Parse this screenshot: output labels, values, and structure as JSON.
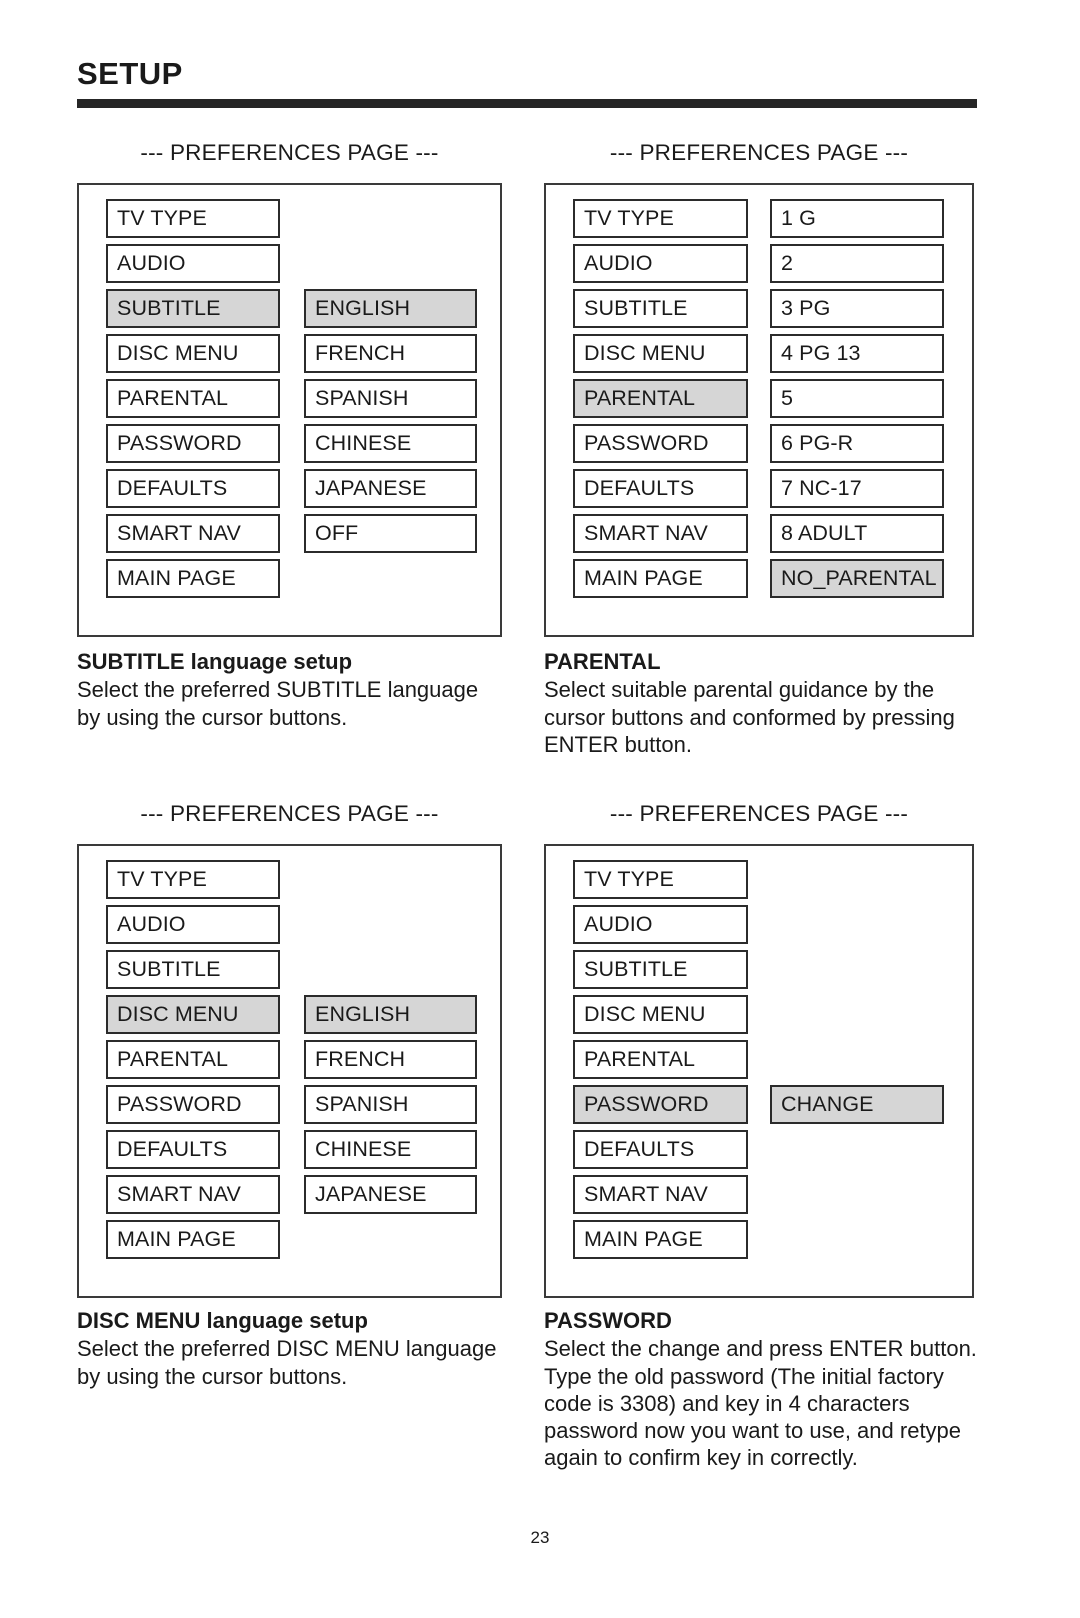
{
  "header": {
    "title": "SETUP"
  },
  "page_number": "23",
  "panels": [
    {
      "id": "subtitle-language",
      "caption": "--- PREFERENCES PAGE ---",
      "left_column": [
        {
          "label": "TV TYPE",
          "highlighted": false
        },
        {
          "label": "AUDIO",
          "highlighted": false
        },
        {
          "label": "SUBTITLE",
          "highlighted": true
        },
        {
          "label": "DISC MENU",
          "highlighted": false
        },
        {
          "label": "PARENTAL",
          "highlighted": false
        },
        {
          "label": "PASSWORD",
          "highlighted": false
        },
        {
          "label": "DEFAULTS",
          "highlighted": false
        },
        {
          "label": "SMART NAV",
          "highlighted": false
        },
        {
          "label": "MAIN PAGE",
          "highlighted": false
        }
      ],
      "right_column_start_row": 2,
      "right_column": [
        {
          "label": "ENGLISH",
          "highlighted": true
        },
        {
          "label": "FRENCH",
          "highlighted": false
        },
        {
          "label": "SPANISH",
          "highlighted": false
        },
        {
          "label": "CHINESE",
          "highlighted": false
        },
        {
          "label": "JAPANESE",
          "highlighted": false
        },
        {
          "label": "OFF",
          "highlighted": false
        }
      ],
      "description_title": "SUBTITLE language setup",
      "description_body": "Select the preferred SUBTITLE language by using the cursor buttons."
    },
    {
      "id": "parental",
      "caption": "--- PREFERENCES PAGE ---",
      "left_column": [
        {
          "label": "TV TYPE",
          "highlighted": false
        },
        {
          "label": "AUDIO",
          "highlighted": false
        },
        {
          "label": "SUBTITLE",
          "highlighted": false
        },
        {
          "label": "DISC MENU",
          "highlighted": false
        },
        {
          "label": "PARENTAL",
          "highlighted": true
        },
        {
          "label": "PASSWORD",
          "highlighted": false
        },
        {
          "label": "DEFAULTS",
          "highlighted": false
        },
        {
          "label": "SMART NAV",
          "highlighted": false
        },
        {
          "label": "MAIN PAGE",
          "highlighted": false
        }
      ],
      "right_column_start_row": 0,
      "right_column": [
        {
          "label": "1 G",
          "highlighted": false
        },
        {
          "label": "2",
          "highlighted": false
        },
        {
          "label": "3 PG",
          "highlighted": false
        },
        {
          "label": "4 PG 13",
          "highlighted": false
        },
        {
          "label": "5",
          "highlighted": false
        },
        {
          "label": "6 PG-R",
          "highlighted": false
        },
        {
          "label": "7 NC-17",
          "highlighted": false
        },
        {
          "label": "8 ADULT",
          "highlighted": false
        },
        {
          "label": "NO_PARENTAL",
          "highlighted": true
        }
      ],
      "description_title": "PARENTAL",
      "description_body": "Select suitable parental guidance by the cursor buttons and conformed by pressing ENTER button."
    },
    {
      "id": "disc-menu-language",
      "caption": "--- PREFERENCES PAGE ---",
      "left_column": [
        {
          "label": "TV TYPE",
          "highlighted": false
        },
        {
          "label": "AUDIO",
          "highlighted": false
        },
        {
          "label": "SUBTITLE",
          "highlighted": false
        },
        {
          "label": "DISC MENU",
          "highlighted": true
        },
        {
          "label": "PARENTAL",
          "highlighted": false
        },
        {
          "label": "PASSWORD",
          "highlighted": false
        },
        {
          "label": "DEFAULTS",
          "highlighted": false
        },
        {
          "label": "SMART NAV",
          "highlighted": false
        },
        {
          "label": "MAIN PAGE",
          "highlighted": false
        }
      ],
      "right_column_start_row": 3,
      "right_column": [
        {
          "label": "ENGLISH",
          "highlighted": true
        },
        {
          "label": "FRENCH",
          "highlighted": false
        },
        {
          "label": "SPANISH",
          "highlighted": false
        },
        {
          "label": "CHINESE",
          "highlighted": false
        },
        {
          "label": "JAPANESE",
          "highlighted": false
        }
      ],
      "description_title": "DISC MENU language setup",
      "description_body": "Select the preferred DISC MENU language by using the cursor buttons."
    },
    {
      "id": "password",
      "caption": "--- PREFERENCES PAGE ---",
      "left_column": [
        {
          "label": "TV TYPE",
          "highlighted": false
        },
        {
          "label": "AUDIO",
          "highlighted": false
        },
        {
          "label": "SUBTITLE",
          "highlighted": false
        },
        {
          "label": "DISC MENU",
          "highlighted": false
        },
        {
          "label": "PARENTAL",
          "highlighted": false
        },
        {
          "label": "PASSWORD",
          "highlighted": true
        },
        {
          "label": "DEFAULTS",
          "highlighted": false
        },
        {
          "label": "SMART NAV",
          "highlighted": false
        },
        {
          "label": "MAIN PAGE",
          "highlighted": false
        }
      ],
      "right_column_start_row": 5,
      "right_column": [
        {
          "label": "CHANGE",
          "highlighted": true
        }
      ],
      "description_title": "PASSWORD",
      "description_body": "Select the change and press ENTER button.  Type the old password (The initial factory code is 3308) and key in 4 characters password now you want to use, and retype again to confirm key in correctly."
    }
  ],
  "colors": {
    "highlight": "#d6d6d6",
    "box_border": "#2b2b2b",
    "panel_border": "#3a3a3a",
    "rule": "#262626",
    "text": "#1a1a1a"
  }
}
